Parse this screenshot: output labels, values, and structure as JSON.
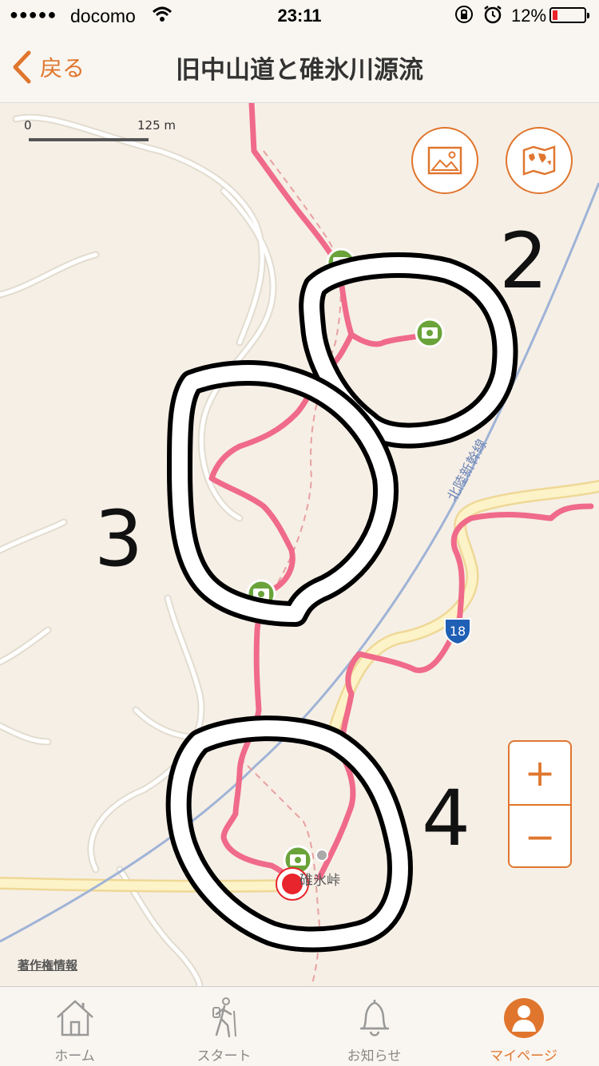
{
  "status_bar": {
    "signal_dots": "●●●●●",
    "carrier": "docomo",
    "time": "23:11",
    "battery_percent": "12%",
    "battery_level": 0.12
  },
  "nav": {
    "back_label": "戻る",
    "title": "旧中山道と碓氷川源流"
  },
  "map": {
    "scale_start": "0",
    "scale_end": "125 m",
    "copyright": "著作権情報",
    "railway_label": "北陸新幹線",
    "route_number": "18",
    "place_label": "碓氷峠",
    "annotations": [
      "2",
      "3",
      "4"
    ],
    "photo_button_icon": "photo-icon",
    "map_style_button_icon": "world-map-icon",
    "zoom_in": "+",
    "zoom_out": "−",
    "colors": {
      "route": "#f06a8a",
      "accent": "#e0762e",
      "photo_marker": "#6aa33a",
      "current_location": "#e8242c"
    }
  },
  "tabs": [
    {
      "label": "ホーム",
      "icon": "home-icon"
    },
    {
      "label": "スタート",
      "icon": "hiker-icon"
    },
    {
      "label": "お知らせ",
      "icon": "bell-icon"
    },
    {
      "label": "マイページ",
      "icon": "user-icon",
      "active": true
    }
  ]
}
